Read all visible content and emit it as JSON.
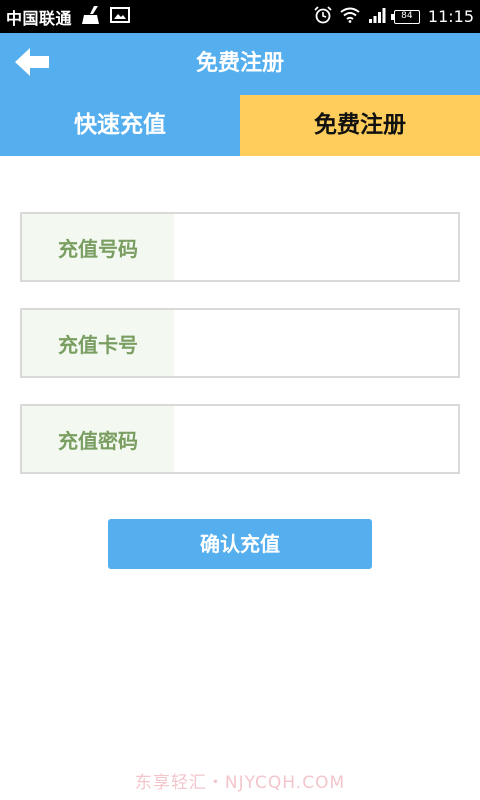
{
  "status_bar": {
    "carrier": "中国联通",
    "battery": "84",
    "time": "11:15",
    "icons": [
      "broom-icon",
      "image-icon",
      "alarm-icon",
      "wifi-icon",
      "signal-icon",
      "battery-icon"
    ]
  },
  "header": {
    "title": "免费注册",
    "back_icon": "arrow-left-icon"
  },
  "tabs": [
    {
      "label": "快速充值",
      "active": false
    },
    {
      "label": "免费注册",
      "active": true
    }
  ],
  "form": {
    "fields": [
      {
        "label": "充值号码",
        "value": ""
      },
      {
        "label": "充值卡号",
        "value": ""
      },
      {
        "label": "充值密码",
        "value": ""
      }
    ],
    "submit_label": "确认充值"
  },
  "watermark": "东享轻汇・NJYCQH.COM",
  "colors": {
    "primary": "#55aeee",
    "tab_active": "#fecd5b",
    "label_text": "#7a9e62",
    "label_bg": "#f3f8f0"
  }
}
